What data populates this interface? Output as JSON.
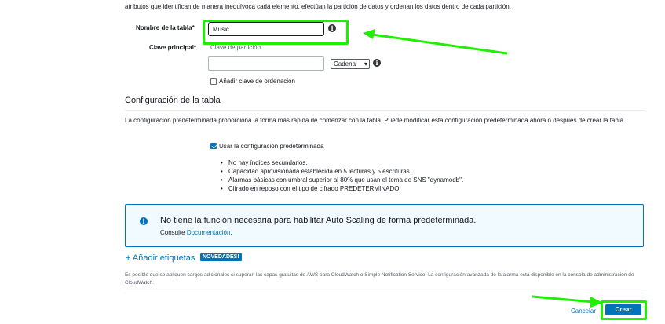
{
  "intro_text": "atributos que identifican de manera inequívoca cada elemento, efectúan la partición de datos y ordenan los datos dentro de cada partición.",
  "table_name": {
    "label": "Nombre de la tabla*",
    "value": "Music"
  },
  "primary_key": {
    "label": "Clave principal*",
    "partition_label": "Clave de partición",
    "partition_value": "",
    "type_select_value": "Cadena",
    "sort_key_label": "Añadir clave de ordenación",
    "sort_key_checked": false
  },
  "table_settings": {
    "heading": "Configuración de la tabla",
    "description": "La configuración predeterminada proporciona la forma más rápida de comenzar con la tabla. Puede modificar esta configuración predeterminada ahora o después de crear la tabla.",
    "use_default_label": "Usar la configuración predeterminada",
    "use_default_checked": true,
    "defaults": [
      "No hay índices secundarios.",
      "Capacidad aprovisionada establecida en 5 lecturas y 5 escrituras.",
      "Alarmas básicas con umbral superior al 80% que usan el tema de SNS \"dynamodb\".",
      "Cifrado en reposo con el tipo de cifrado PREDETERMINADO."
    ]
  },
  "alert": {
    "title": "No tiene la función necesaria para habilitar Auto Scaling de forma predeterminada.",
    "consult_label": "Consulte",
    "doc_link": "Documentación",
    "suffix": "."
  },
  "tags": {
    "add_label": "+ Añadir etiquetas",
    "badge": "NOVEDADES!"
  },
  "footnote": "Es posible que se apliquen cargos adicionales si superan las capas gratuitas de AWS para CloudWatch o Simple Notification Service. La configuración avanzada de la alarma está disponible en la consola de administración de CloudWatch.",
  "actions": {
    "cancel": "Cancelar",
    "create": "Crear"
  },
  "colors": {
    "accent": "#0073bb",
    "highlight": "#1fef00",
    "alert_border": "#0073bb"
  },
  "icons": {
    "info": "info-icon",
    "alert": "info-circle-icon",
    "arrow": "arrow-annotation"
  }
}
